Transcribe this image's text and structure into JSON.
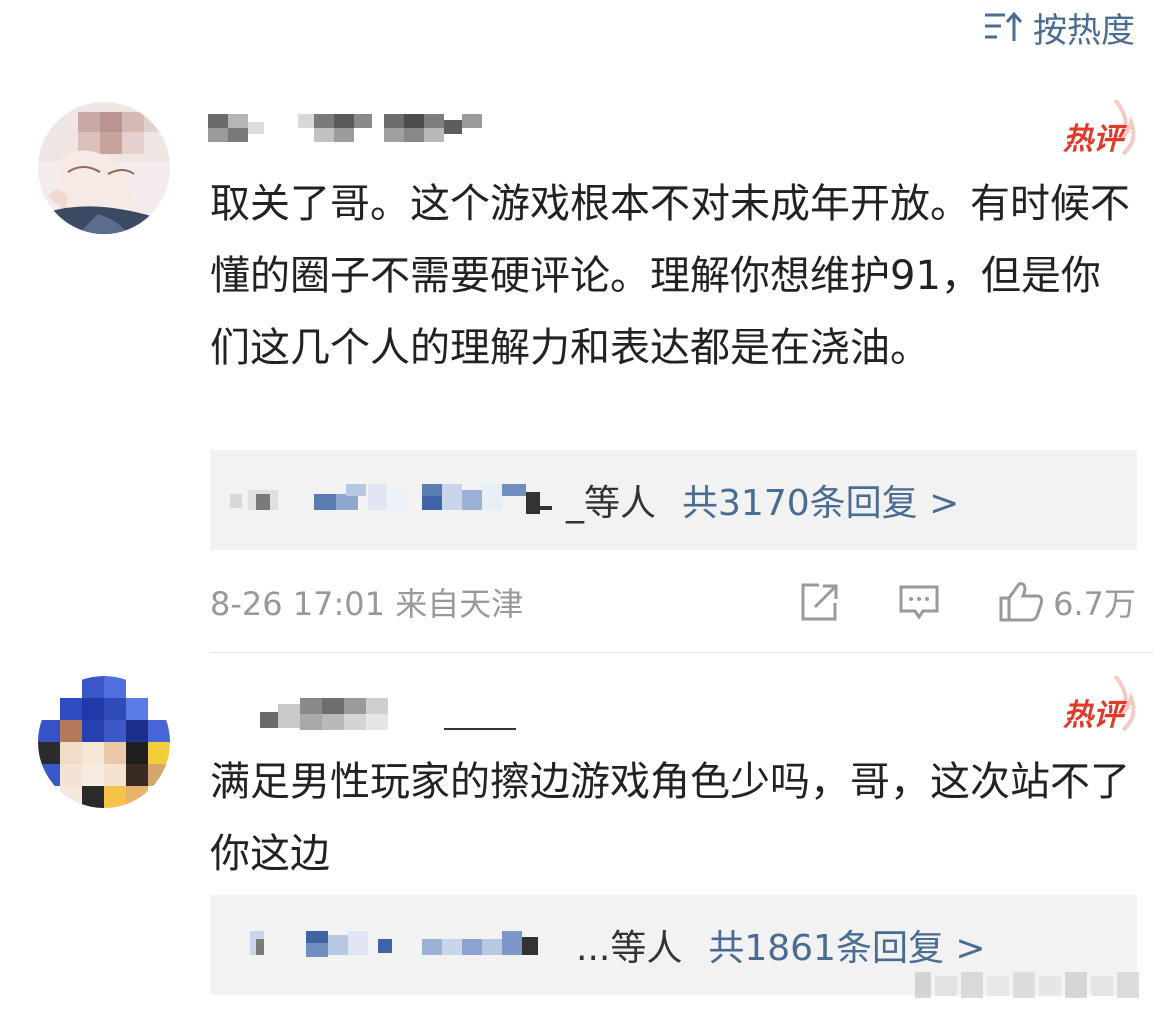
{
  "sort": {
    "label": "按热度",
    "icon": "sort-hot-icon"
  },
  "hot_badge_label": "热评",
  "comments": [
    {
      "text": "取关了哥。这个游戏根本不对未成年开放。有时候不懂的圈子不需要硬评论。理解你想维护91，但是你们这几个人的理解力和表达都是在浇油。",
      "reply_suffix": "_等人",
      "reply_count": "共3170条回复 >",
      "time": "8-26 17:01 来自天津",
      "likes": "6.7万"
    },
    {
      "text": "满足男性玩家的擦边游戏角色少吗，哥，这次站不了你这边",
      "reply_suffix": "...等人",
      "reply_count": "共1861条回复 >"
    }
  ],
  "colors": {
    "link": "#4a6b93",
    "hot": "#e03a2a",
    "meta": "#999999",
    "reply_bg": "#f2f2f2"
  }
}
